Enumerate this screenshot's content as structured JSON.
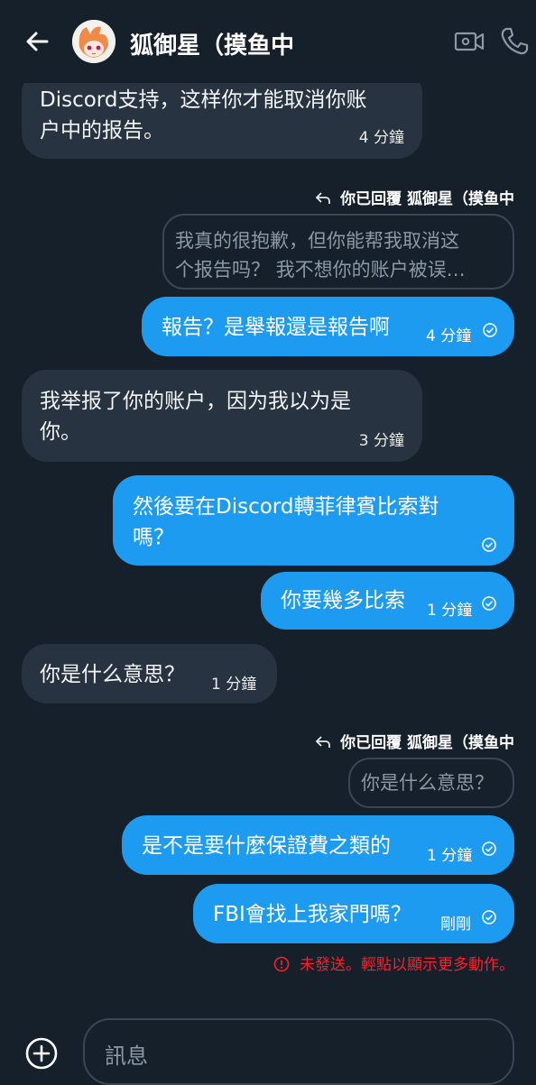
{
  "header": {
    "title": "狐御星（摸鱼中",
    "back_icon": "arrow-left-icon",
    "video_icon": "video-call-icon",
    "phone_icon": "phone-call-icon"
  },
  "messages": [
    {
      "direction": "in",
      "text": "Discord支持，这样你才能取消你账\n户中的报告。",
      "time": "4 分鐘"
    },
    {
      "direction": "out",
      "reply_label": "你已回覆 狐御星（摸鱼中",
      "quote": "我真的很抱歉，但你能帮我取消这\n个报告吗？ 我不想你的账户被误…",
      "text": "報告？是舉報還是報告啊",
      "time": "4 分鐘"
    },
    {
      "direction": "in",
      "text": "我举报了你的账户，因为我以为是\n你。",
      "time": "3 分鐘"
    },
    {
      "direction": "out",
      "text": "然後要在Discord轉菲律賓比索對\n嗎？",
      "time": ""
    },
    {
      "direction": "out",
      "text": "你要幾多比索",
      "time": "1 分鐘"
    },
    {
      "direction": "in",
      "text": "你是什么意思？",
      "time": "1 分鐘"
    },
    {
      "direction": "out",
      "reply_label": "你已回覆 狐御星（摸鱼中",
      "quote": "你是什么意思？",
      "text": "是不是要什麼保證費之類的",
      "time": "1 分鐘"
    },
    {
      "direction": "out",
      "text": "FBI會找上我家門嗎？",
      "time": "剛剛"
    }
  ],
  "error": {
    "text": "未發送。輕點以顯示更多動作。",
    "color": "#f4212e"
  },
  "composer": {
    "placeholder": "訊息",
    "plus_icon": "add-circle-icon"
  },
  "colors": {
    "background": "#15202b",
    "incoming": "#273340",
    "outgoing": "#1d9bf0"
  }
}
